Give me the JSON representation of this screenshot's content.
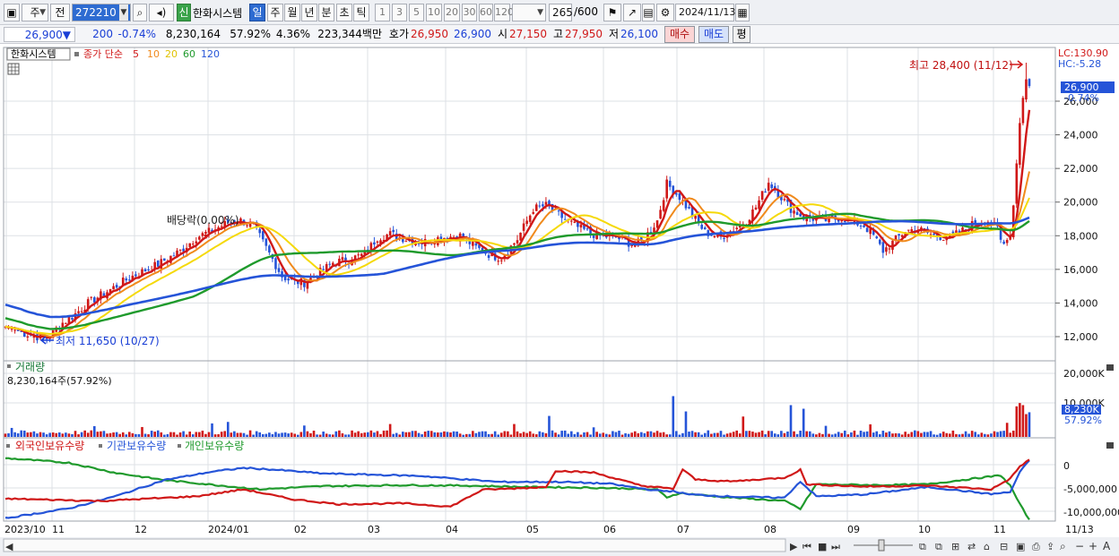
{
  "toolbar": {
    "period_unit": "주",
    "prev_label": "전",
    "stock_code": "272210",
    "stock_badge": "신",
    "stock_name": "한화시스템",
    "period_tabs": [
      "일",
      "주",
      "월",
      "년",
      "분",
      "초",
      "틱"
    ],
    "selected_tab": "일",
    "interval_buttons": [
      "1",
      "3",
      "5",
      "10",
      "20",
      "30",
      "60",
      "120"
    ],
    "count_value": "265",
    "count_total": "/600",
    "date": "2024/11/13"
  },
  "quote": {
    "price": "26,900",
    "change_arrow": "▼",
    "change": "200",
    "change_pct": "-0.74%",
    "volume": "8,230,164",
    "volume_ratio": "57.92%",
    "turnover_rate": "4.36%",
    "trade_value": "223,344백만",
    "ask_label": "호가",
    "ask": "26,950",
    "bid": "26,900",
    "open_label": "시",
    "open": "27,150",
    "high_label": "고",
    "high": "27,950",
    "low_label": "저",
    "low": "26,100",
    "buy_label": "매수",
    "sell_label": "매도",
    "avg_label": "평"
  },
  "price_pane": {
    "legend": {
      "name": "한화시스템",
      "type": "종가 단순",
      "periods": [
        "5",
        "10",
        "20",
        "60",
        "120"
      ],
      "colors": [
        "#d01818",
        "#f08a1c",
        "#f5d90a",
        "#1f9a2c",
        "#2554d8"
      ]
    },
    "lc_label": "LC:130.90",
    "hc_label": "HC:-5.28",
    "price_tag": "26,900",
    "price_tag_pct": "-0.74%",
    "max_annotation": "최고 28,400 (11/12)",
    "min_annotation": "최저 11,650 (10/27)",
    "dividend_annotation": "배당락(0.00%)",
    "y_ticks": [
      "26,000",
      "24,000",
      "22,000",
      "20,000",
      "18,000",
      "16,000",
      "14,000",
      "12,000"
    ]
  },
  "volume_pane": {
    "title": "거래량",
    "value_label": "8,230,164주(57.92%)",
    "y_ticks": [
      "20,000K",
      "10,000K"
    ],
    "tag_value": "8,230K",
    "tag_pct": "57.92%"
  },
  "holding_pane": {
    "legend": [
      "외국인보유수량",
      "기관보유수량",
      "개인보유수량"
    ],
    "colors": [
      "#d01818",
      "#2554d8",
      "#1f9a2c"
    ],
    "y_ticks": [
      "0",
      "-5,000,000",
      "-10,000,000"
    ]
  },
  "x_axis": {
    "labels": [
      "2023/10",
      "11",
      "12",
      "2024/01",
      "02",
      "03",
      "04",
      "05",
      "06",
      "07",
      "08",
      "09",
      "10",
      "11"
    ],
    "right_label": "11/13"
  },
  "chart_data": {
    "type": "candlestick",
    "start_date": "2023-10-05",
    "end_date": "2024-11-13",
    "ylim": [
      11000,
      28400
    ],
    "close_anchors": [
      [
        0,
        12600
      ],
      [
        6,
        12200
      ],
      [
        12,
        11900
      ],
      [
        14,
        12000
      ],
      [
        17,
        12700
      ],
      [
        21,
        13200
      ],
      [
        26,
        14000
      ],
      [
        33,
        14800
      ],
      [
        40,
        15600
      ],
      [
        48,
        16300
      ],
      [
        55,
        17100
      ],
      [
        60,
        17900
      ],
      [
        66,
        18400
      ],
      [
        70,
        18800
      ],
      [
        74,
        18900
      ],
      [
        78,
        18600
      ],
      [
        81,
        17600
      ],
      [
        84,
        16600
      ],
      [
        87,
        15600
      ],
      [
        90,
        15300
      ],
      [
        94,
        15200
      ],
      [
        98,
        15700
      ],
      [
        103,
        16400
      ],
      [
        108,
        16600
      ],
      [
        113,
        16900
      ],
      [
        117,
        17900
      ],
      [
        121,
        18100
      ],
      [
        126,
        17800
      ],
      [
        131,
        17600
      ],
      [
        137,
        17900
      ],
      [
        143,
        18000
      ],
      [
        148,
        17300
      ],
      [
        153,
        16800
      ],
      [
        156,
        16700
      ],
      [
        161,
        17800
      ],
      [
        166,
        19600
      ],
      [
        170,
        19800
      ],
      [
        175,
        19100
      ],
      [
        180,
        18500
      ],
      [
        186,
        18000
      ],
      [
        192,
        17900
      ],
      [
        197,
        17500
      ],
      [
        200,
        17600
      ],
      [
        205,
        18900
      ],
      [
        208,
        21100
      ],
      [
        212,
        20300
      ],
      [
        215,
        19500
      ],
      [
        220,
        18200
      ],
      [
        225,
        17900
      ],
      [
        229,
        18400
      ],
      [
        233,
        18900
      ],
      [
        236,
        19700
      ],
      [
        240,
        21200
      ],
      [
        244,
        20300
      ],
      [
        247,
        19600
      ],
      [
        251,
        19100
      ],
      [
        255,
        19000
      ],
      [
        259,
        18900
      ],
      [
        263,
        19100
      ],
      [
        267,
        18800
      ],
      [
        270,
        18600
      ],
      [
        273,
        18000
      ],
      [
        276,
        17100
      ],
      [
        279,
        17600
      ],
      [
        283,
        18300
      ],
      [
        287,
        18400
      ],
      [
        292,
        18000
      ],
      [
        297,
        17900
      ],
      [
        302,
        18400
      ],
      [
        305,
        18800
      ],
      [
        309,
        18900
      ],
      [
        312,
        18400
      ],
      [
        313,
        17700
      ],
      [
        314,
        17500
      ],
      [
        316,
        18000
      ],
      [
        317,
        19800
      ],
      [
        318,
        22300
      ],
      [
        319,
        24700
      ],
      [
        320,
        26200
      ],
      [
        321,
        27300
      ],
      [
        322,
        26900
      ]
    ],
    "moving_average_periods": [
      5,
      10,
      20,
      60,
      120
    ],
    "volume_peaks_k": [
      [
        2,
        3000
      ],
      [
        28,
        3600
      ],
      [
        43,
        3300
      ],
      [
        65,
        4500
      ],
      [
        70,
        5000
      ],
      [
        94,
        3800
      ],
      [
        121,
        4300
      ],
      [
        160,
        4300
      ],
      [
        171,
        7000
      ],
      [
        185,
        3200
      ],
      [
        210,
        13600
      ],
      [
        214,
        8500
      ],
      [
        232,
        6800
      ],
      [
        247,
        10600
      ],
      [
        251,
        9400
      ],
      [
        258,
        3700
      ],
      [
        272,
        4200
      ],
      [
        315,
        4700
      ],
      [
        318,
        10200
      ],
      [
        319,
        11300
      ],
      [
        320,
        10600
      ],
      [
        321,
        7600
      ],
      [
        322,
        8230
      ]
    ],
    "holding_series": {
      "foreign": [
        [
          0,
          -7300000
        ],
        [
          30,
          -7800000
        ],
        [
          60,
          -6800000
        ],
        [
          75,
          -5300000
        ],
        [
          90,
          -7400000
        ],
        [
          105,
          -8500000
        ],
        [
          125,
          -8300000
        ],
        [
          140,
          -9000000
        ],
        [
          150,
          -5400000
        ],
        [
          170,
          -4800000
        ],
        [
          173,
          -1300000
        ],
        [
          185,
          -1700000
        ],
        [
          200,
          -4500000
        ],
        [
          210,
          -5200000
        ],
        [
          213,
          -1000000
        ],
        [
          217,
          -3200000
        ],
        [
          228,
          -3600000
        ],
        [
          245,
          -2800000
        ],
        [
          250,
          -1100000
        ],
        [
          252,
          -4200000
        ],
        [
          270,
          -4700000
        ],
        [
          290,
          -4500000
        ],
        [
          310,
          -5300000
        ],
        [
          316,
          -3000000
        ],
        [
          319,
          -400000
        ],
        [
          322,
          1100000
        ]
      ],
      "institution": [
        [
          0,
          -11500000
        ],
        [
          20,
          -9400000
        ],
        [
          35,
          -6700000
        ],
        [
          50,
          -3300000
        ],
        [
          65,
          -1500000
        ],
        [
          75,
          -700000
        ],
        [
          85,
          -1100000
        ],
        [
          100,
          -1900000
        ],
        [
          130,
          -2400000
        ],
        [
          155,
          -3700000
        ],
        [
          175,
          -3700000
        ],
        [
          190,
          -4100000
        ],
        [
          205,
          -5600000
        ],
        [
          210,
          -5700000
        ],
        [
          215,
          -6400000
        ],
        [
          230,
          -6900000
        ],
        [
          245,
          -7100000
        ],
        [
          250,
          -3600000
        ],
        [
          255,
          -6800000
        ],
        [
          270,
          -6400000
        ],
        [
          290,
          -4800000
        ],
        [
          310,
          -6300000
        ],
        [
          316,
          -5900000
        ],
        [
          319,
          -1600000
        ],
        [
          322,
          900000
        ]
      ],
      "foreign_color": "#d01818",
      "individual": [
        [
          0,
          1400000
        ],
        [
          20,
          400000
        ],
        [
          35,
          -1800000
        ],
        [
          50,
          -3300000
        ],
        [
          65,
          -4300000
        ],
        [
          80,
          -5300000
        ],
        [
          100,
          -4600000
        ],
        [
          125,
          -4400000
        ],
        [
          145,
          -4500000
        ],
        [
          165,
          -4800000
        ],
        [
          180,
          -4900000
        ],
        [
          195,
          -5100000
        ],
        [
          205,
          -5400000
        ],
        [
          208,
          -7000000
        ],
        [
          212,
          -6100000
        ],
        [
          225,
          -6900000
        ],
        [
          245,
          -7800000
        ],
        [
          250,
          -9500000
        ],
        [
          255,
          -4200000
        ],
        [
          275,
          -4400000
        ],
        [
          290,
          -4200000
        ],
        [
          308,
          -2700000
        ],
        [
          313,
          -2300000
        ],
        [
          316,
          -4500000
        ],
        [
          319,
          -8500000
        ],
        [
          322,
          -11800000
        ]
      ]
    }
  }
}
